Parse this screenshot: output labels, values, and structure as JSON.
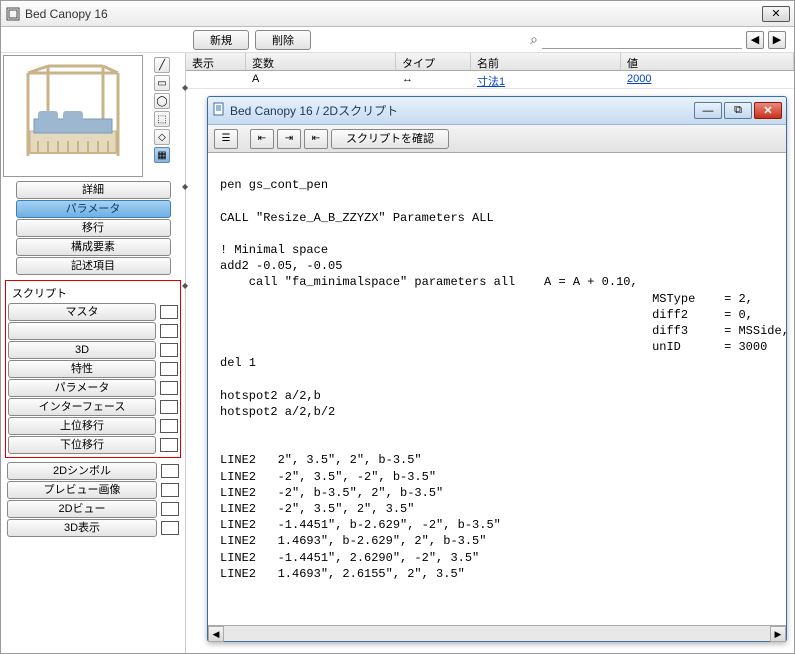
{
  "outer": {
    "title": "Bed Canopy 16",
    "close_icon": "✕"
  },
  "toolbar": {
    "new": "新規",
    "delete": "削除",
    "search_placeholder": "",
    "search_icon": "⌕",
    "prev": "◀",
    "next": "▶"
  },
  "paramHeader": {
    "c1": "表示",
    "c2": "変数",
    "c3": "タイプ",
    "c4": "名前",
    "c5": "値"
  },
  "paramRow": {
    "c1": "",
    "c2": "A",
    "c3_icon": "↔",
    "c4": "寸法1",
    "c5": "2000"
  },
  "nav": {
    "detail": "詳細",
    "parameter": "パラメータ",
    "migrate": "移行",
    "components": "構成要素",
    "descitems": "記述項目"
  },
  "scriptGroup": {
    "label": "スクリプト",
    "master": "マスタ",
    "blank": "",
    "three_d": "3D",
    "props": "特性",
    "param": "パラメータ",
    "iface": "インターフェース",
    "upmig": "上位移行",
    "downmig": "下位移行"
  },
  "extra": {
    "sym2d": "2Dシンボル",
    "preview": "プレビュー画像",
    "view2d": "2Dビュー",
    "view3d": "3D表示"
  },
  "scriptWin": {
    "title": "Bed Canopy 16 / 2Dスクリプト",
    "min": "—",
    "max": "⧉",
    "close": "✕",
    "check": "スクリプトを確認"
  },
  "code": "\npen gs_cont_pen\n\nCALL \"Resize_A_B_ZZYZX\" Parameters ALL\n\n! Minimal space\nadd2 -0.05, -0.05\n    call \"fa_minimalspace\" parameters all    A = A + 0.10,\n                                                            MSType    = 2,\n                                                            diff2     = 0,\n                                                            diff3     = MSSide,\n                                                            unID      = 3000\ndel 1\n\nhotspot2 a/2,b\nhotspot2 a/2,b/2\n\n\nLINE2   2\", 3.5\", 2\", b-3.5\"\nLINE2   -2\", 3.5\", -2\", b-3.5\"\nLINE2   -2\", b-3.5\", 2\", b-3.5\"\nLINE2   -2\", 3.5\", 2\", 3.5\"\nLINE2   -1.4451\", b-2.629\", -2\", b-3.5\"\nLINE2   1.4693\", b-2.629\", 2\", b-3.5\"\nLINE2   -1.4451\", 2.6290\", -2\", 3.5\"\nLINE2   1.4693\", 2.6155\", 2\", 3.5\""
}
